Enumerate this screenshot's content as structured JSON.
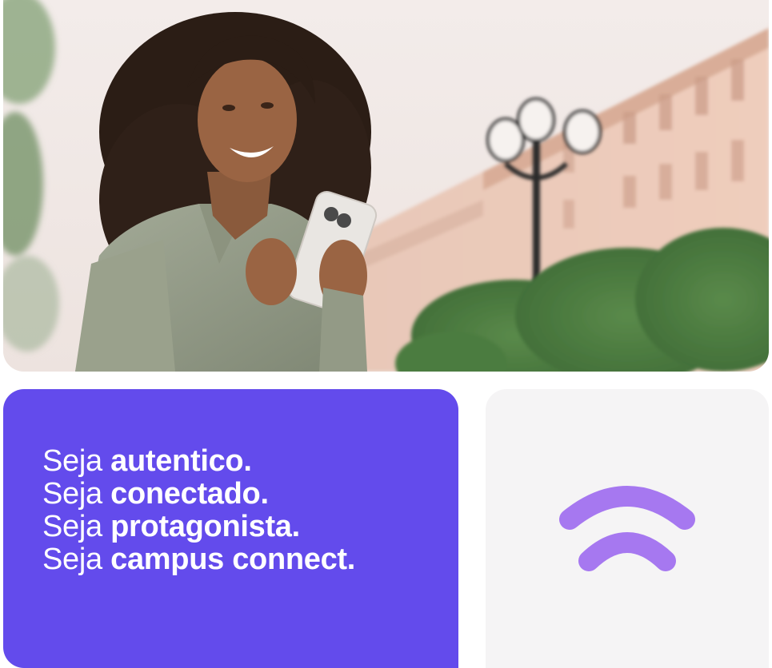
{
  "hero": {
    "image": "woman-smiling-with-smartphone-photo"
  },
  "slogan": {
    "lines": [
      {
        "prefix": "Seja",
        "emphasis": "autentico."
      },
      {
        "prefix": "Seja",
        "emphasis": "conectado."
      },
      {
        "prefix": "Seja",
        "emphasis": "protagonista."
      },
      {
        "prefix": "Seja",
        "emphasis": "campus connect."
      }
    ]
  },
  "logo": {
    "icon": "campus-connect-signal-icon",
    "color": "#a678f0"
  },
  "colors": {
    "slogan_background": "#634bec",
    "slogan_text": "#ffffff",
    "logo_card_background": "#f5f4f5"
  }
}
